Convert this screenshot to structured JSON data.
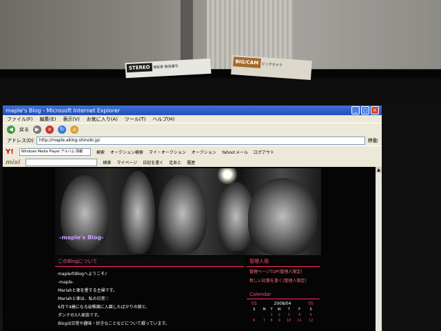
{
  "stickers": [
    {
      "logo": "STEREO",
      "text": "保証書  製造番号"
    },
    {
      "logo": "BIG/CAM",
      "text": "ビックカメラ"
    }
  ],
  "window": {
    "title": "maple's Blog - Microsoft Internet Explorer",
    "menu": [
      "ファイル(F)",
      "編集(E)",
      "表示(V)",
      "お気に入り(A)",
      "ツール(T)",
      "ヘルプ(H)"
    ],
    "toolbar": {
      "back_label": "戻る"
    },
    "address": {
      "label": "アドレス(D)",
      "url": "http://maple.ablog.shinobi.jp/",
      "go_label": "移動"
    }
  },
  "yahoo_bar": {
    "logo": "Y!",
    "input_value": "Windows Media Player アルバム 情報",
    "search_label": "検索",
    "items": [
      "オークション検索",
      "マイ・オークション",
      "オークション",
      "Yahoo!メール",
      "ログアウト"
    ]
  },
  "mixi_bar": {
    "logo": "mixi",
    "search_label": "検索",
    "items": [
      "マイページ",
      "日記を書く",
      "足あと",
      "履歴"
    ]
  },
  "blog": {
    "title": "-maple's Blog-",
    "about_heading": "このBlogについて",
    "post": [
      "mapleのBlogへようこそ♪",
      "-maple-",
      "Mariahと車を愛する主婦です。",
      "Mariahと車は、私の日常♡",
      "6月で4歳になる幼稚園に入園したばかりの娘と、",
      "ダンナの3人家族です。",
      "Blogは日常や趣味・好きなことなどについて綴っています。"
    ],
    "admin_heading": "管理人用",
    "admin_links": [
      "管理ページTOP(管理人限定)",
      "新しい記事を書く(管理人限定)"
    ],
    "calendar": {
      "heading": "Calendar",
      "prev": "03",
      "month": "2008/04",
      "next": "05",
      "weekdays": [
        "S",
        "M",
        "T",
        "W",
        "T",
        "F",
        "S"
      ],
      "rows": [
        [
          "",
          "",
          "1",
          "2",
          "3",
          "4",
          "5"
        ],
        [
          "6",
          "7",
          "8",
          "9",
          "10",
          "11",
          "12"
        ]
      ]
    }
  }
}
